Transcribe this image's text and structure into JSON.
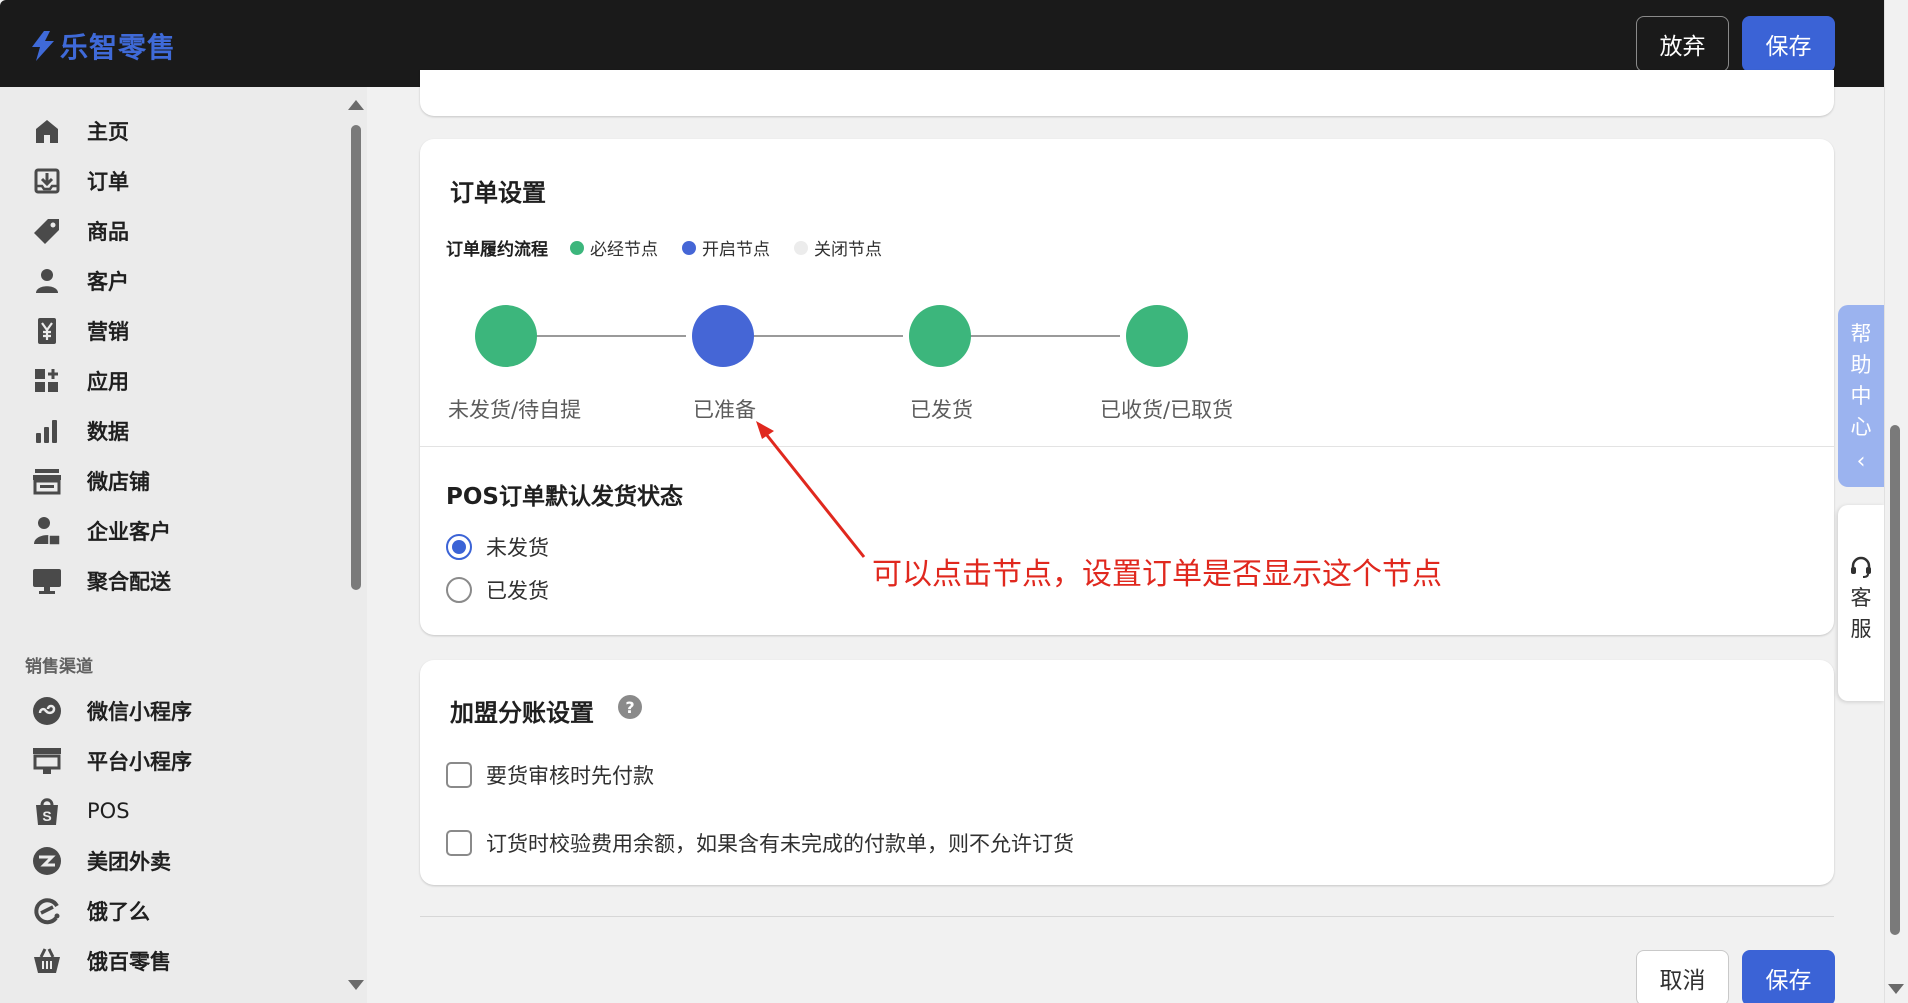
{
  "app": {
    "logo_text": "乐智零售",
    "brand_color": "#3f6ad8"
  },
  "header": {
    "discard_label": "放弃",
    "save_label": "保存"
  },
  "sidebar": {
    "items": [
      {
        "label": "主页",
        "icon": "home-icon"
      },
      {
        "label": "订单",
        "icon": "order-inbox-icon"
      },
      {
        "label": "商品",
        "icon": "tag-icon"
      },
      {
        "label": "客户",
        "icon": "person-icon"
      },
      {
        "label": "营销",
        "icon": "yen-icon"
      },
      {
        "label": "应用",
        "icon": "apps-grid-icon"
      },
      {
        "label": "数据",
        "icon": "bar-chart-icon"
      },
      {
        "label": "微店铺",
        "icon": "store-icon"
      },
      {
        "label": "企业客户",
        "icon": "business-user-icon"
      },
      {
        "label": "聚合配送",
        "icon": "monitor-icon"
      }
    ],
    "section_title": "销售渠道",
    "channels": [
      {
        "label": "微信小程序",
        "icon": "mini-program-icon"
      },
      {
        "label": "平台小程序",
        "icon": "platform-icon"
      },
      {
        "label": "POS",
        "icon": "pos-bag-icon"
      },
      {
        "label": "美团外卖",
        "icon": "meituan-icon"
      },
      {
        "label": "饿了么",
        "icon": "eleme-icon"
      },
      {
        "label": "饿百零售",
        "icon": "basket-icon"
      }
    ]
  },
  "order_settings": {
    "title": "订单设置",
    "legend_title": "订单履约流程",
    "legend": [
      {
        "label": "必经节点",
        "color": "#3cb67c"
      },
      {
        "label": "开启节点",
        "color": "#4566d6"
      },
      {
        "label": "关闭节点",
        "color": "#ececec"
      }
    ],
    "flow_nodes": [
      {
        "label": "未发货/待自提",
        "state": "required",
        "color": "#3cb67c"
      },
      {
        "label": "已准备",
        "state": "enabled",
        "color": "#4566d6"
      },
      {
        "label": "已发货",
        "state": "required",
        "color": "#3cb67c"
      },
      {
        "label": "已收货/已取货",
        "state": "required",
        "color": "#3cb67c"
      }
    ],
    "pos_title": "POS订单默认发货状态",
    "pos_options": [
      {
        "label": "未发货",
        "checked": true
      },
      {
        "label": "已发货",
        "checked": false
      }
    ]
  },
  "annotation": {
    "text": "可以点击节点，设置订单是否显示这个节点",
    "color": "#e0281e"
  },
  "franchise_settings": {
    "title": "加盟分账设置",
    "help_icon_glyph": "?",
    "options": [
      {
        "label": "要货审核时先付款",
        "checked": false
      },
      {
        "label": "订货时校验费用余额，如果含有未完成的付款单，则不允许订货",
        "checked": false
      }
    ]
  },
  "footer": {
    "cancel_label": "取消",
    "save_label": "保存"
  },
  "right_widgets": {
    "help_center": [
      "帮",
      "助",
      "中",
      "心"
    ],
    "help_center_chevron": "‹",
    "service": [
      "客",
      "服"
    ]
  }
}
